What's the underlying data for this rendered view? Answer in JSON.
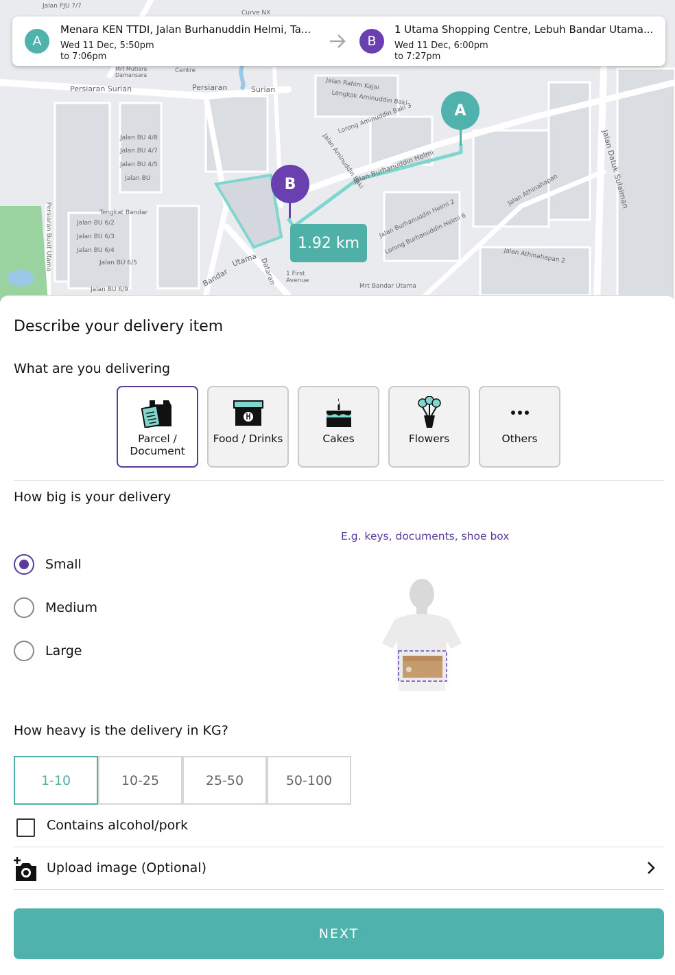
{
  "route": {
    "pickup": {
      "marker": "A",
      "address": "Menara KEN TTDI, Jalan Burhanuddin Helmi, Ta...",
      "date": "Wed 11 Dec, 5:50pm",
      "until": "to 7:06pm"
    },
    "dropoff": {
      "marker": "B",
      "address": "1 Utama Shopping Centre, Lebuh Bandar Utama...",
      "date": "Wed 11 Dec, 6:00pm",
      "until": "to 7:27pm"
    },
    "arrow_icon": "arrow-right-icon"
  },
  "map": {
    "distance": "1.92 km",
    "pin_a": "A",
    "pin_b": "B",
    "labels": [
      "Jalan PJU 7/7",
      "Curve NX",
      "Persiaran Surian",
      "Persiaran",
      "Surian",
      "Mrt Mutiara Damansara",
      "Centre",
      "Jalan Rahim Kajai",
      "Lengkok Aminuddin Baki",
      "Lorong Aminuddin Baki 3",
      "Jalan Burhanuddin Helmi",
      "Jalan BU 4/8",
      "Jalan BU 4/7",
      "Jalan BU 4/5",
      "Jalan BU",
      "Tengkat Bandar",
      "Jalan BU 6/2",
      "Jalan BU 6/3",
      "Jalan BU 6/4",
      "Jalan BU 6/5",
      "Jalan BU 6/9",
      "Bandar",
      "Utama",
      "Dataran",
      "1 First Avenue",
      "Mrt Bandar Utama",
      "Jalan Athinahapan",
      "Jalan Athinahapan 2",
      "Jalan Datuk Sulaiman",
      "Persiaran Bukit Utama",
      "Jalan Aminuddin Baki",
      "Lorong Burhanuddin Helmi 6",
      "Jalan Burhanuddin Helmi 2"
    ],
    "colors": {
      "route": "#7fd6cf",
      "pin_a": "#50b2ac",
      "pin_b": "#6a3fb0",
      "park": "#9ad3a0",
      "water": "#9cc8e8"
    }
  },
  "form": {
    "title": "Describe your delivery item",
    "category_question": "What are you delivering",
    "categories": [
      {
        "label": "Parcel / Document",
        "icon": "parcel-document-icon",
        "selected": true
      },
      {
        "label": "Food / Drinks",
        "icon": "food-box-icon",
        "selected": false
      },
      {
        "label": "Cakes",
        "icon": "cake-icon",
        "selected": false
      },
      {
        "label": "Flowers",
        "icon": "flowers-icon",
        "selected": false
      },
      {
        "label": "Others",
        "icon": "more-dots-icon",
        "selected": false
      }
    ],
    "size_question": "How big is your delivery",
    "size_example": "E.g. keys, documents, shoe box",
    "sizes": [
      {
        "label": "Small",
        "checked": true
      },
      {
        "label": "Medium",
        "checked": false
      },
      {
        "label": "Large",
        "checked": false
      }
    ],
    "weight_question": "How heavy is the delivery in KG?",
    "weights": [
      {
        "label": "1-10",
        "selected": true
      },
      {
        "label": "10-25",
        "selected": false
      },
      {
        "label": "25-50",
        "selected": false
      },
      {
        "label": "50-100",
        "selected": false
      }
    ],
    "alcohol_label": "Contains alcohol/pork",
    "alcohol_checked": false,
    "upload_label": "Upload image (Optional)",
    "upload_icon": "add-camera-icon",
    "chevron_icon": "chevron-right-icon",
    "next_label": "NEXT",
    "colors": {
      "accent": "#50b2ac",
      "purple": "#5a3a9a"
    }
  }
}
